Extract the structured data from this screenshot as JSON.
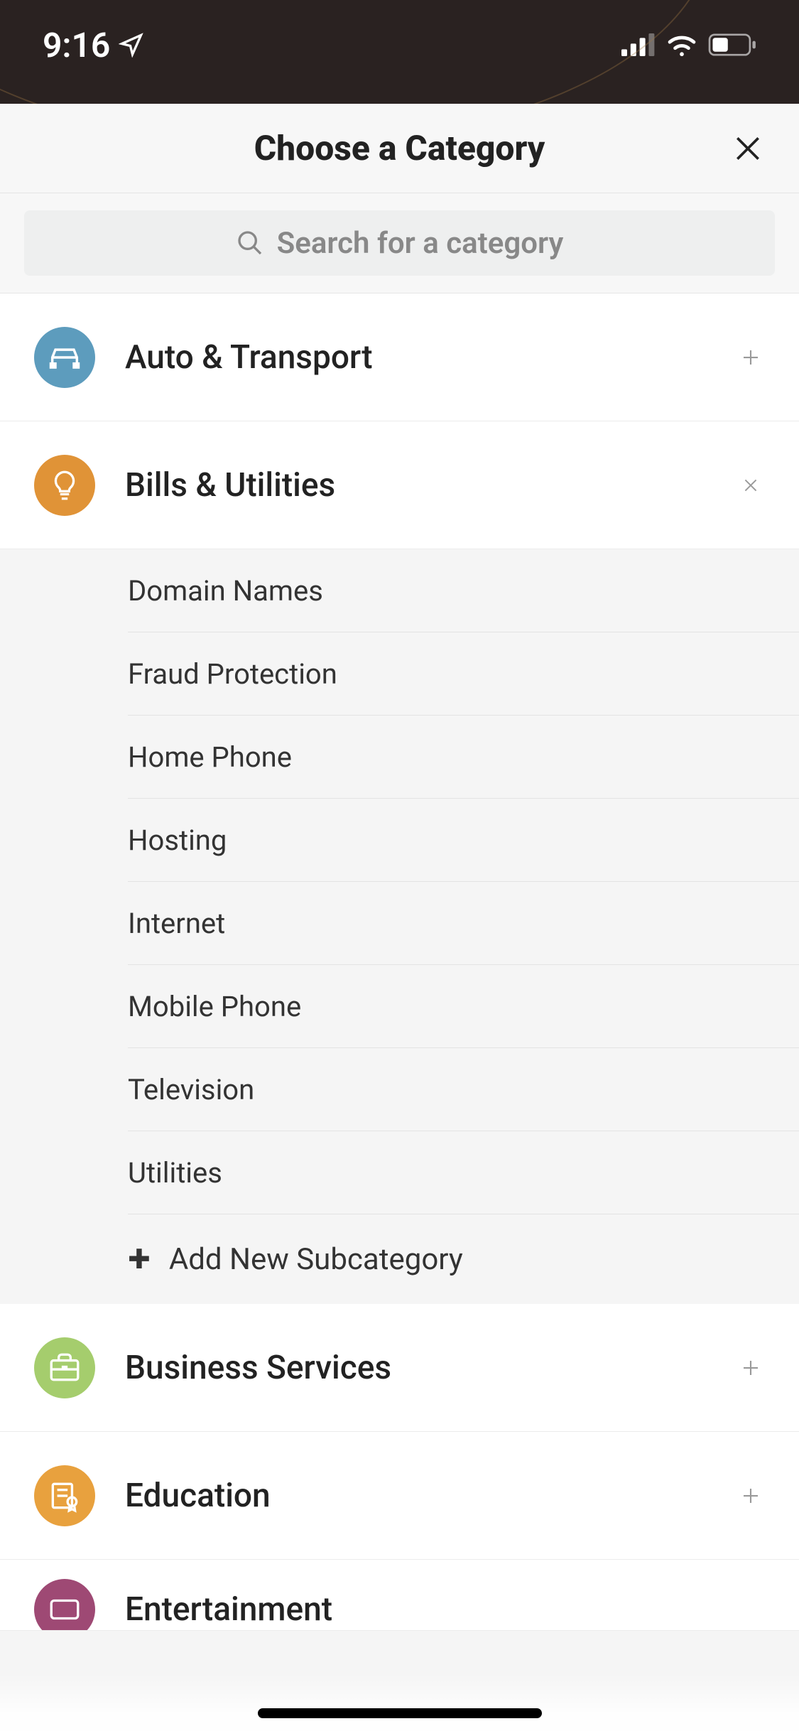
{
  "status": {
    "time": "9:16"
  },
  "header": {
    "title": "Choose a Category"
  },
  "search": {
    "placeholder": "Search for a category"
  },
  "categories": [
    {
      "label": "Auto & Transport",
      "expanded": false
    },
    {
      "label": "Bills & Utilities",
      "expanded": true
    },
    {
      "label": "Business Services",
      "expanded": false
    },
    {
      "label": "Education",
      "expanded": false
    },
    {
      "label": "Entertainment",
      "expanded": false
    }
  ],
  "subcategories": {
    "bills": [
      "Domain Names",
      "Fraud Protection",
      "Home Phone",
      "Hosting",
      "Internet",
      "Mobile Phone",
      "Television",
      "Utilities"
    ]
  },
  "actions": {
    "add_subcategory": "Add New Subcategory"
  }
}
